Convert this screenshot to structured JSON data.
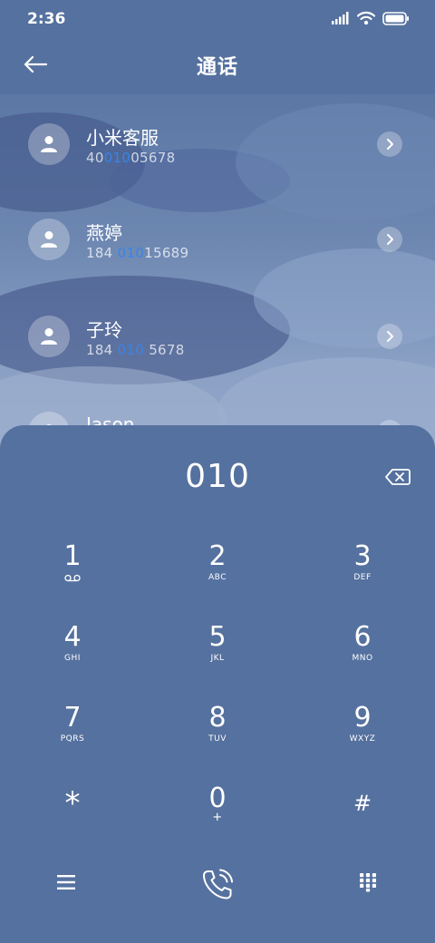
{
  "status_bar": {
    "time": "2:36"
  },
  "header": {
    "title": "通话"
  },
  "contacts": [
    {
      "name": "小米客服",
      "number_pre": "40",
      "number_match": "010",
      "number_post": "05678"
    },
    {
      "name": "燕婷",
      "number_pre": "184 ",
      "number_match": "010",
      "number_post": "15689"
    },
    {
      "name": "子玲",
      "number_pre": "184 ",
      "number_match": "010",
      "number_post": " 5678"
    },
    {
      "name": "Jason",
      "number_pre": "",
      "number_match": "",
      "number_post": ""
    }
  ],
  "dialpad": {
    "input_value": "010",
    "keys": [
      {
        "digit": "1",
        "letters": ""
      },
      {
        "digit": "2",
        "letters": "ABC"
      },
      {
        "digit": "3",
        "letters": "DEF"
      },
      {
        "digit": "4",
        "letters": "GHI"
      },
      {
        "digit": "5",
        "letters": "JKL"
      },
      {
        "digit": "6",
        "letters": "MNO"
      },
      {
        "digit": "7",
        "letters": "PQRS"
      },
      {
        "digit": "8",
        "letters": "TUV"
      },
      {
        "digit": "9",
        "letters": "WXYZ"
      },
      {
        "digit": "*",
        "letters": ""
      },
      {
        "digit": "0",
        "letters": "+"
      },
      {
        "digit": "#",
        "letters": ""
      }
    ]
  },
  "icons": {
    "back": "arrow-left-icon",
    "backspace": "backspace-icon",
    "voicemail": "voicemail-icon",
    "menu": "menu-icon",
    "call": "phone-call-icon",
    "dialpad_toggle": "dialpad-icon"
  },
  "colors": {
    "background": "#55719f",
    "match_highlight": "#3a84e6"
  }
}
